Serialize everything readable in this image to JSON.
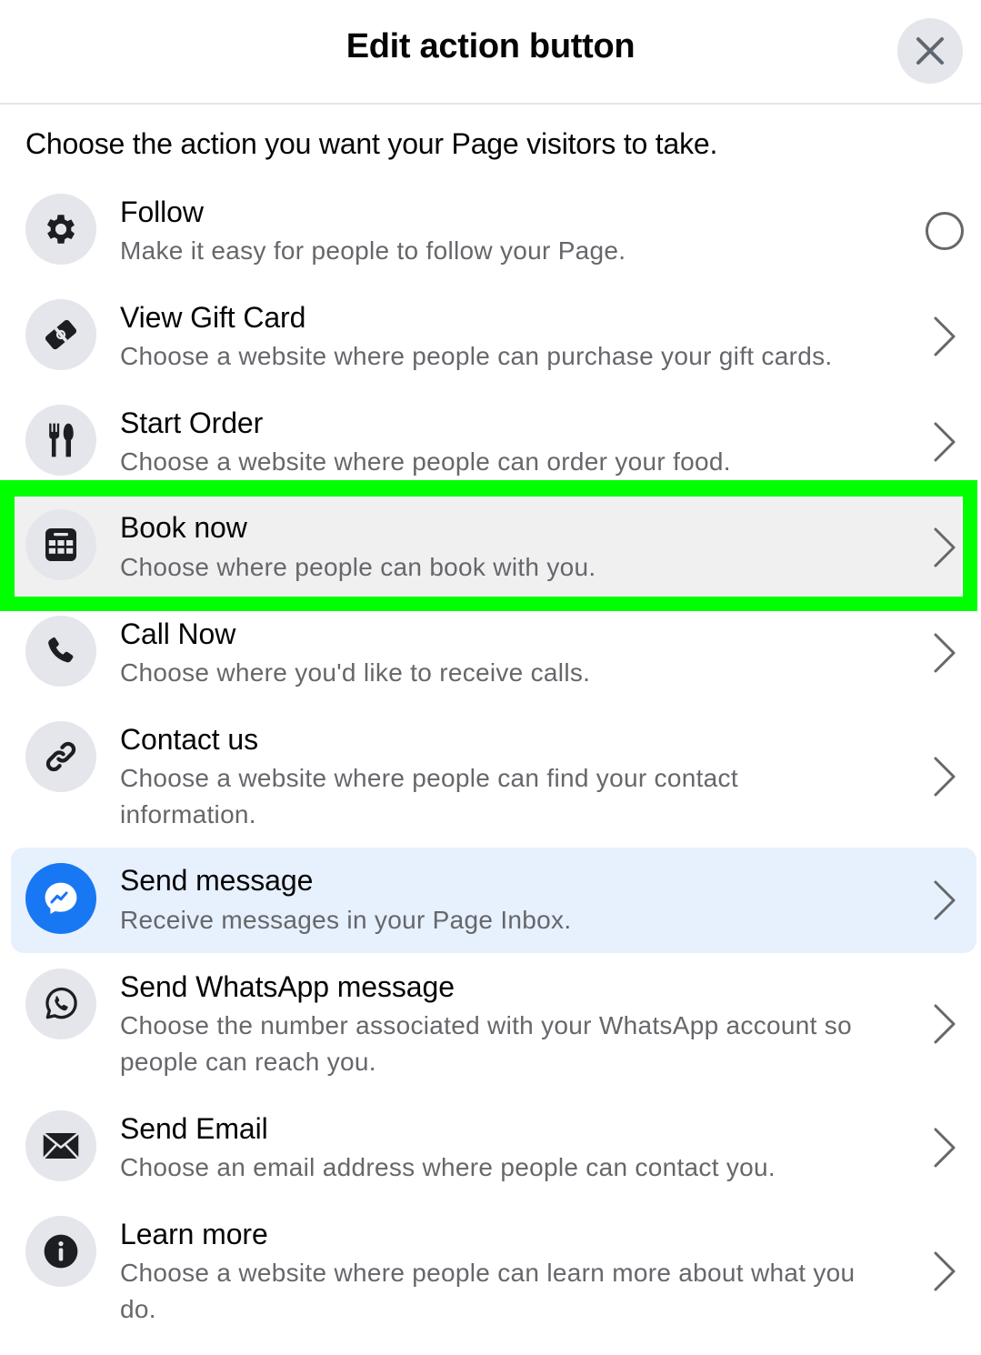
{
  "header": {
    "title": "Edit action button",
    "close_icon": "close-icon"
  },
  "prompt": "Choose the action you want your Page visitors to take.",
  "options": [
    {
      "title": "Follow",
      "description": "Make it easy for people to follow your Page.",
      "icon": "gear-icon",
      "control": "radio",
      "selected": false
    },
    {
      "title": "View Gift Card",
      "description": "Choose a website where people can purchase your gift cards.",
      "icon": "gift-card-icon",
      "control": "chevron"
    },
    {
      "title": "Start Order",
      "description": "Choose a website where people can order your food.",
      "icon": "fork-knife-icon",
      "control": "chevron"
    },
    {
      "title": "Book now",
      "description": "Choose where people can book with you.",
      "icon": "calendar-icon",
      "control": "chevron",
      "highlighted": true
    },
    {
      "title": "Call Now",
      "description": "Choose where you'd like to receive calls.",
      "icon": "phone-icon",
      "control": "chevron"
    },
    {
      "title": "Contact us",
      "description": "Choose a website where people can find your contact information.",
      "icon": "link-icon",
      "control": "chevron"
    },
    {
      "title": "Send message",
      "description": "Receive messages in your Page Inbox.",
      "icon": "messenger-icon",
      "control": "chevron",
      "active": true
    },
    {
      "title": "Send WhatsApp message",
      "description": "Choose the number associated with your WhatsApp account so people can reach you.",
      "icon": "whatsapp-icon",
      "control": "chevron"
    },
    {
      "title": "Send Email",
      "description": "Choose an email address where people can contact you.",
      "icon": "envelope-icon",
      "control": "chevron"
    },
    {
      "title": "Learn more",
      "description": "Choose a website where people can learn more about what you do.",
      "icon": "info-icon",
      "control": "chevron"
    }
  ],
  "colors": {
    "highlight_border": "#00ff00",
    "active_row_bg": "#e7f0fd",
    "messenger_blue": "#1877f2",
    "icon_bg": "#e4e6eb",
    "secondary_text": "#65676b"
  }
}
